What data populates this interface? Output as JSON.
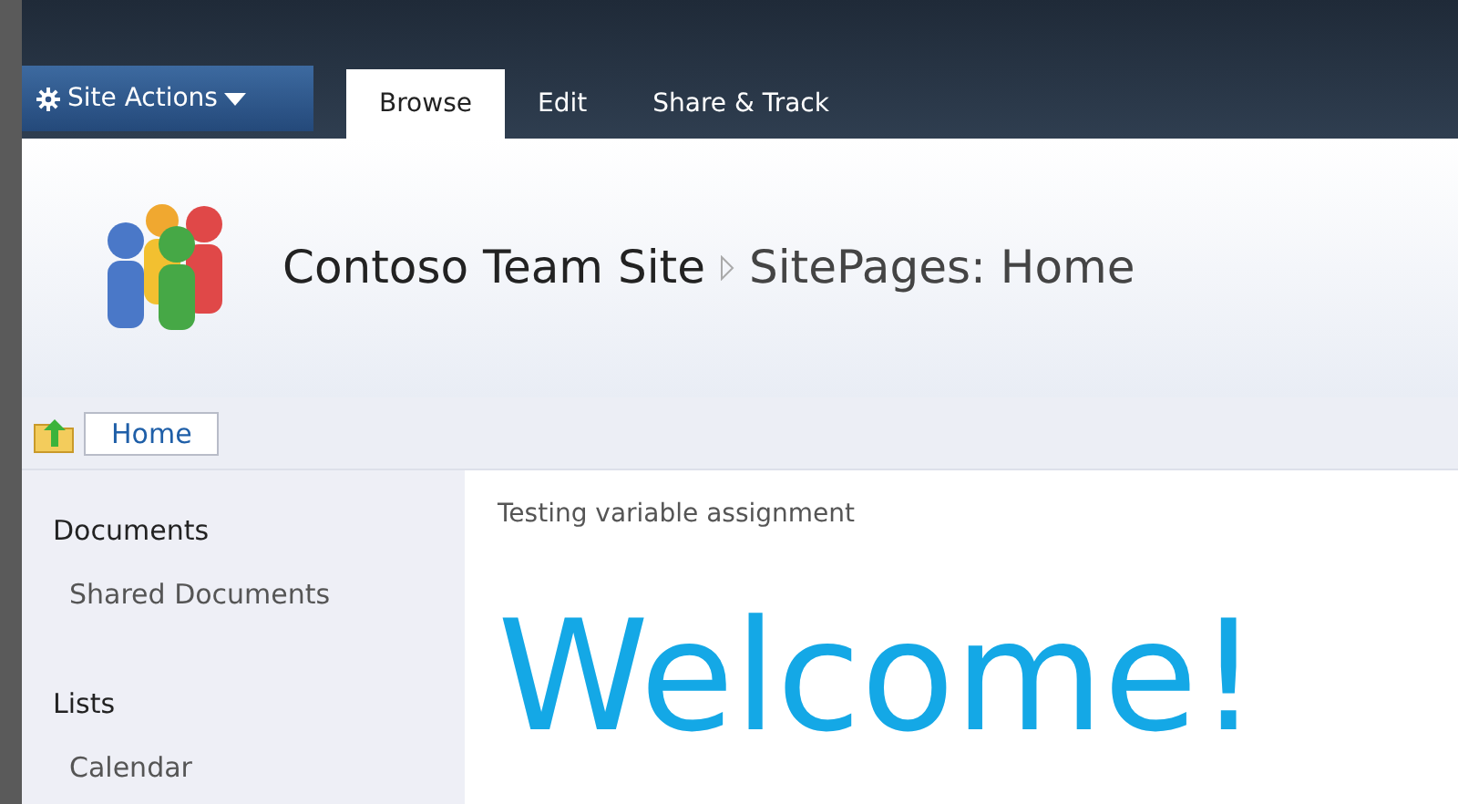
{
  "ribbon": {
    "site_actions": "Site Actions",
    "tabs": [
      {
        "label": "Browse",
        "selected": true
      },
      {
        "label": "Edit",
        "selected": false
      },
      {
        "label": "Share & Track",
        "selected": false
      }
    ]
  },
  "header": {
    "site_title": "Contoso Team Site",
    "page_title": "SitePages: Home"
  },
  "breadcrumb": {
    "label": "Home"
  },
  "sidebar": {
    "sections": [
      {
        "heading": "Documents",
        "items": [
          "Shared Documents"
        ]
      },
      {
        "heading": "Lists",
        "items": [
          "Calendar"
        ]
      }
    ]
  },
  "content": {
    "intro": "Testing variable assignment",
    "heading": "Welcome!"
  }
}
